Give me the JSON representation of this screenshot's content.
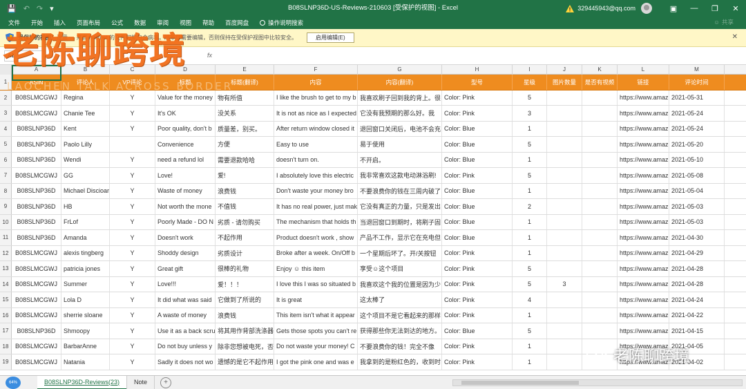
{
  "window": {
    "title": "B08SLNP36D-US-Reviews-210603  [受保护的视图]  -  Excel",
    "account": "329445943@qq.com"
  },
  "menu": {
    "items": [
      "文件",
      "开始",
      "插入",
      "页面布局",
      "公式",
      "数据",
      "审阅",
      "视图",
      "帮助",
      "百度网盘"
    ],
    "search": "操作说明搜索",
    "share": "共享"
  },
  "protected_bar": {
    "title": "受保护的视图",
    "text": "注意 — 来自 Internet 的文件可能包含病毒。除非您需要编辑，否则保持在受保护视图中比较安全。",
    "button": "启用编辑(E)"
  },
  "name_box": "A1",
  "columns": [
    "A",
    "B",
    "C",
    "D",
    "E",
    "F",
    "G",
    "H",
    "I",
    "J",
    "K",
    "L",
    "M"
  ],
  "header_row": [
    "ASIN",
    "评论人",
    "VP评论",
    "标题",
    "标题(翻译)",
    "内容",
    "内容(翻译)",
    "型号",
    "星级",
    "图片数量",
    "是否有视频",
    "链接",
    "评论时间"
  ],
  "rows": [
    {
      "n": "2",
      "cells": [
        "B08SLMCGWJ",
        "Regina",
        "Y",
        "Value for the money",
        "物有所值",
        "I like the brush to get to my b",
        "我喜欢刷子回到我的背上。很",
        "Color: Pink",
        "5",
        "",
        "",
        "https://www.amaz",
        "2021-05-31"
      ]
    },
    {
      "n": "3",
      "cells": [
        "B08SLMCGWJ",
        "Chanie Tee",
        "Y",
        "It's OK",
        "没关系",
        "It is not as nice as I expected",
        "它没有我预期的那么好。我",
        "Color: Pink",
        "3",
        "",
        "",
        "https://www.amaz",
        "2021-05-24"
      ]
    },
    {
      "n": "4",
      "cells": [
        "B08SLNP36D",
        "Kent",
        "Y",
        "Poor quality, don't b",
        "质量差，别买。",
        "After return window closed it",
        "退回窗口关闭后，电池不会充",
        "Color: Blue",
        "1",
        "",
        "",
        "https://www.amaz",
        "2021-05-24"
      ]
    },
    {
      "n": "5",
      "cells": [
        "B08SLNP36D",
        "Paolo Lilly",
        "",
        "Convenience",
        "方便",
        "Easy to use",
        "易于使用",
        "Color: Blue",
        "5",
        "",
        "",
        "https://www.amaz",
        "2021-05-20"
      ]
    },
    {
      "n": "6",
      "cells": [
        "B08SLNP36D",
        "Wendi",
        "Y",
        "need a refund lol",
        "需要退款哈哈",
        "doesn't turn on.",
        "不开启。",
        "Color: Blue",
        "1",
        "",
        "",
        "https://www.amaz",
        "2021-05-10"
      ]
    },
    {
      "n": "7",
      "cells": [
        "B08SLMCGWJ",
        "GG",
        "Y",
        "Love!",
        "爱!",
        "I absolutely love this electric",
        "我非常喜欢这款电动淋浴刷!",
        "Color: Pink",
        "5",
        "",
        "",
        "https://www.amaz",
        "2021-05-08"
      ]
    },
    {
      "n": "8",
      "cells": [
        "B08SLNP36D",
        "Michael Discioar",
        "Y",
        "Waste of money",
        "浪费钱",
        "Don't waste your money bro",
        "不要浪费你的钱在三周内破了",
        "Color: Blue",
        "1",
        "",
        "",
        "https://www.amaz",
        "2021-05-04"
      ]
    },
    {
      "n": "9",
      "cells": [
        "B08SLNP36D",
        "HB",
        "Y",
        "Not worth the mone",
        "不值钱",
        "It has no real power, just mak",
        "它没有真正的力量，只是发出",
        "Color: Blue",
        "2",
        "",
        "",
        "https://www.amaz",
        "2021-05-03"
      ]
    },
    {
      "n": "10",
      "cells": [
        "B08SLNP36D",
        "FrLof",
        "Y",
        "Poorly Made - DO N",
        "劣质 - 请勿购买",
        "The mechanism that holds th",
        "当退回窗口到期时，将刷子固",
        "Color: Blue",
        "1",
        "",
        "",
        "https://www.amaz",
        "2021-05-03"
      ]
    },
    {
      "n": "11",
      "cells": [
        "B08SLNP36D",
        "Amanda",
        "Y",
        "Doesn't work",
        "不起作用",
        "Product doesn't work , show",
        "产品不工作，显示它在充电但",
        "Color: Blue",
        "1",
        "",
        "",
        "https://www.amaz",
        "2021-04-30"
      ]
    },
    {
      "n": "12",
      "cells": [
        "B08SLMCGWJ",
        "alexis tingberg",
        "Y",
        "Shoddy design",
        "劣质设计",
        "Broke after a week. On/Off b",
        "一个星期后坏了。开/关按钮",
        "Color: Pink",
        "1",
        "",
        "",
        "https://www.amaz",
        "2021-04-29"
      ]
    },
    {
      "n": "13",
      "cells": [
        "B08SLMCGWJ",
        "patricia jones",
        "Y",
        "Great gift",
        "很棒的礼物",
        "Enjoy ☺ this item",
        "享受☺这个项目",
        "Color: Pink",
        "5",
        "",
        "",
        "https://www.amaz",
        "2021-04-28"
      ]
    },
    {
      "n": "14",
      "cells": [
        "B08SLMCGWJ",
        "Summer",
        "Y",
        "Love!!!",
        "爱！！！",
        "I love this I was so situated b",
        "我喜欢这个我的位置是因为少",
        "Color: Pink",
        "5",
        "3",
        "",
        "https://www.amaz",
        "2021-04-28"
      ]
    },
    {
      "n": "15",
      "cells": [
        "B08SLMCGWJ",
        "Lola D",
        "Y",
        "It did what was said",
        "它做到了所说的",
        "It is great",
        "这太棒了",
        "Color: Pink",
        "4",
        "",
        "",
        "https://www.amaz",
        "2021-04-24"
      ]
    },
    {
      "n": "16",
      "cells": [
        "B08SLMCGWJ",
        "sherrie sloane",
        "Y",
        "A waste of money",
        "浪费钱",
        "This item isn't what it appear",
        "这个项目不是它看起来的那样",
        "Color: Pink",
        "1",
        "",
        "",
        "https://www.amaz",
        "2021-04-22"
      ]
    },
    {
      "n": "17",
      "cells": [
        "B08SLNP36D",
        "Shmoopy",
        "Y",
        "Use it as a back scru",
        "将其用作背部洗涤器",
        "Gets those spots you can't re",
        "获得那些你无法到达的地方。",
        "Color: Blue",
        "5",
        "",
        "",
        "https://www.amaz",
        "2021-04-15"
      ]
    },
    {
      "n": "18",
      "cells": [
        "B08SLMCGWJ",
        "BarbarAnne",
        "Y",
        "Do not buy unless y",
        "除非您想被电死，否",
        "Do not waste your money! C",
        "不要浪费你的钱！完全不像",
        "Color: Pink",
        "1",
        "",
        "",
        "https://www.amaz",
        "2021-04-05"
      ]
    },
    {
      "n": "19",
      "cells": [
        "B08SLMCGWJ",
        "Natania",
        "Y",
        "Sadly it does not wo",
        "遗憾的是它不起作用",
        "I got the pink one and was e",
        "我拿到的是粉红色的，收到时",
        "Color: Pink",
        "1",
        "",
        "",
        "https://www.amaz",
        "2021-04-02"
      ]
    }
  ],
  "sheet_tabs": [
    "B08SLNP36D-Reviews(23)",
    "Note"
  ],
  "watermark": {
    "logo": "老陈聊跨境",
    "subtitle": "LAOCHEN TALK ACROSS BORDER",
    "channel": "老陈聊跨境",
    "badge": "64%"
  }
}
